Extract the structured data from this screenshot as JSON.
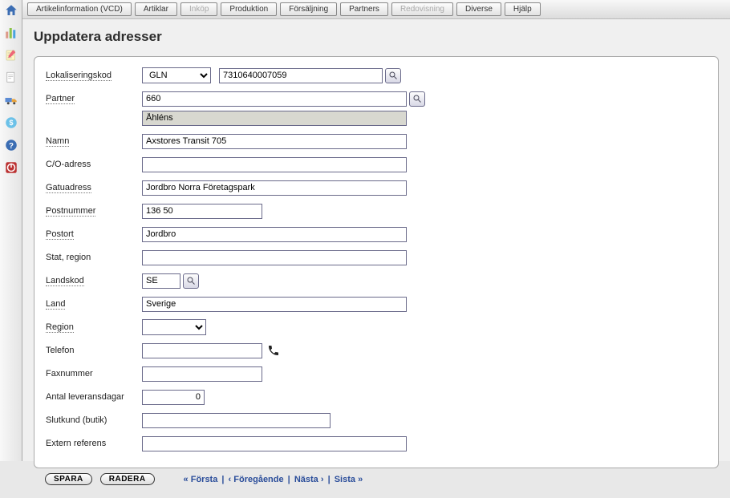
{
  "topnav": {
    "items": [
      {
        "label": "Artikelinformation (VCD)",
        "disabled": false
      },
      {
        "label": "Artiklar",
        "disabled": false
      },
      {
        "label": "Inköp",
        "disabled": true
      },
      {
        "label": "Produktion",
        "disabled": false
      },
      {
        "label": "Försäljning",
        "disabled": false
      },
      {
        "label": "Partners",
        "disabled": false
      },
      {
        "label": "Redovisning",
        "disabled": true
      },
      {
        "label": "Diverse",
        "disabled": false
      },
      {
        "label": "Hjälp",
        "disabled": false
      }
    ]
  },
  "page": {
    "title": "Uppdatera adresser"
  },
  "form": {
    "lokaliseringskod": {
      "label": "Lokaliseringskod",
      "select_value": "GLN",
      "code_value": "7310640007059"
    },
    "partner": {
      "label": "Partner",
      "code": "660",
      "name_readonly": "Åhléns"
    },
    "namn": {
      "label": "Namn",
      "value": "Axstores Transit 705"
    },
    "co_adress": {
      "label": "C/O-adress",
      "value": ""
    },
    "gatuadress": {
      "label": "Gatuadress",
      "value": "Jordbro Norra Företagspark"
    },
    "postnummer": {
      "label": "Postnummer",
      "value": "136 50"
    },
    "postort": {
      "label": "Postort",
      "value": "Jordbro"
    },
    "stat_region": {
      "label": "Stat, region",
      "value": ""
    },
    "landskod": {
      "label": "Landskod",
      "value": "SE"
    },
    "land": {
      "label": "Land",
      "value": "Sverige"
    },
    "region": {
      "label": "Region",
      "value": ""
    },
    "telefon": {
      "label": "Telefon",
      "value": ""
    },
    "faxnummer": {
      "label": "Faxnummer",
      "value": ""
    },
    "antal_leveransdagar": {
      "label": "Antal leveransdagar",
      "value": "0"
    },
    "slutkund": {
      "label": "Slutkund (butik)",
      "value": ""
    },
    "extern_referens": {
      "label": "Extern referens",
      "value": ""
    }
  },
  "footer": {
    "save": "SPARA",
    "delete": "RADERA",
    "first": "« Första",
    "prev": "‹ Föregående",
    "next": "Nästa ›",
    "last": "Sista »"
  }
}
